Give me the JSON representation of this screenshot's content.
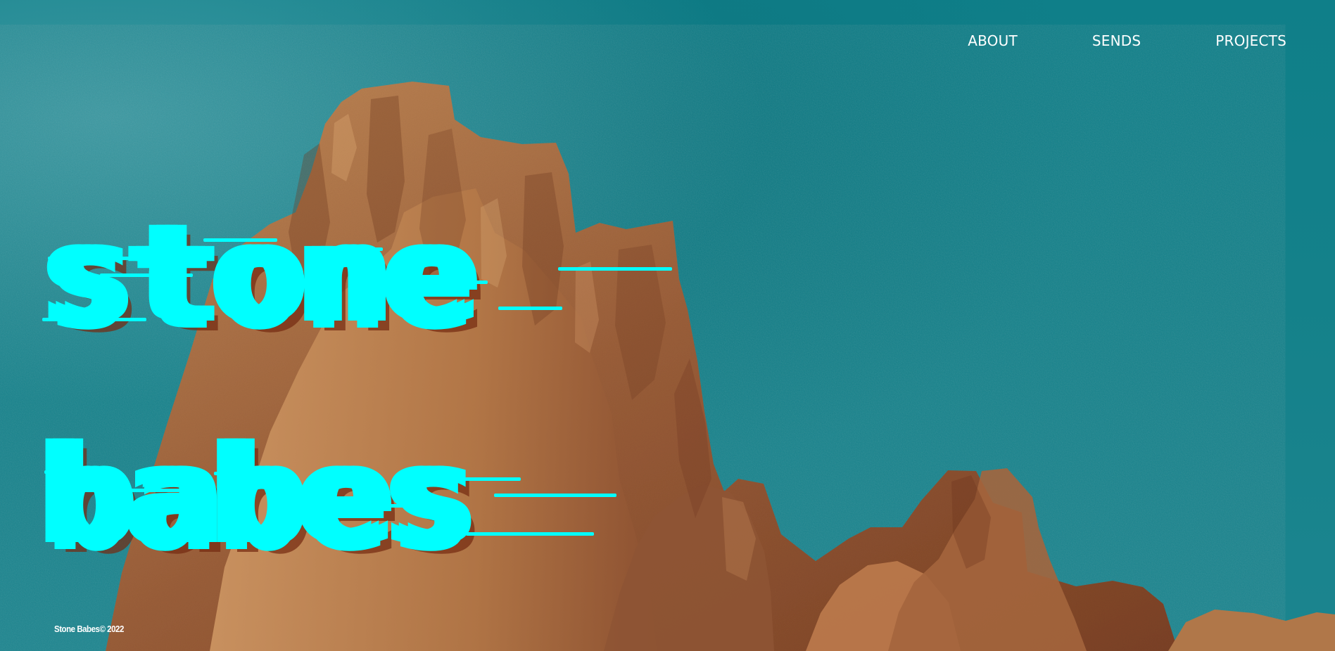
{
  "nav": {
    "items": [
      {
        "label": "ABOUT"
      },
      {
        "label": "SENDS"
      },
      {
        "label": "PROJECTS"
      }
    ]
  },
  "hero": {
    "title_line_1": "stone",
    "title_line_2": "babes"
  },
  "footer": {
    "text": "Stone Babes© 2022"
  },
  "theme": {
    "sky": "#147f88",
    "accent": "#00ffff",
    "rock": "#a86f4b",
    "text": "#ffffff"
  }
}
